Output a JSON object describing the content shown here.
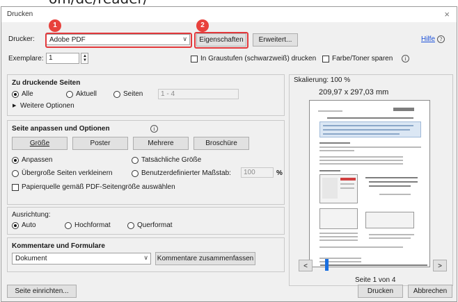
{
  "dialog": {
    "title": "Drucken",
    "close_glyph": "×",
    "cropped_heading": "om/de/reader/"
  },
  "printer": {
    "label": "Drucker:",
    "value": "Adobe PDF",
    "properties_button": "Eigenschaften",
    "advanced_button": "Erweitert..."
  },
  "help": {
    "label": "Hilfe",
    "icon": "question-icon"
  },
  "copies": {
    "label": "Exemplare:",
    "value": "1"
  },
  "options": {
    "grayscale_label": "In Graustufen (schwarzweiß) drucken",
    "save_ink_label": "Farbe/Toner sparen"
  },
  "badges": [
    "1",
    "2"
  ],
  "pages_section": {
    "heading": "Zu druckende Seiten",
    "radio_all": "Alle",
    "radio_current": "Aktuell",
    "radio_pages": "Seiten",
    "pages_range": "1 - 4",
    "more_options": "Weitere Optionen"
  },
  "sizing_section": {
    "heading": "Seite anpassen und Optionen",
    "buttons": [
      "Größe",
      "Poster",
      "Mehrere",
      "Broschüre"
    ],
    "radio_fit": "Anpassen",
    "radio_actual": "Tatsächliche Größe",
    "radio_shrink": "Übergroße Seiten verkleinern",
    "radio_custom": "Benutzerdefinierter Maßstab:",
    "custom_scale": "100",
    "percent": "%",
    "pdf_page_size": "Papierquelle gemäß PDF-Seitengröße auswählen"
  },
  "orientation": {
    "heading": "Ausrichtung:",
    "auto": "Auto",
    "portrait": "Hochformat",
    "landscape": "Querformat"
  },
  "comments": {
    "heading": "Kommentare und Formulare",
    "value": "Dokument",
    "summarize_button": "Kommentare zusammenfassen"
  },
  "preview": {
    "scale_label": "Skalierung: 100 %",
    "dimensions": "209,97 x 297,03 mm",
    "prev_button": "<",
    "next_button": ">",
    "page_indicator": "Seite 1 von 4",
    "page_position": 0.05
  },
  "footer": {
    "page_setup_button": "Seite einrichten...",
    "print_button": "Drucken",
    "cancel_button": "Abbrechen"
  },
  "colors": {
    "highlight": "#e2383b",
    "accent": "#1a4fd8",
    "slider": "#1a6fe0"
  }
}
